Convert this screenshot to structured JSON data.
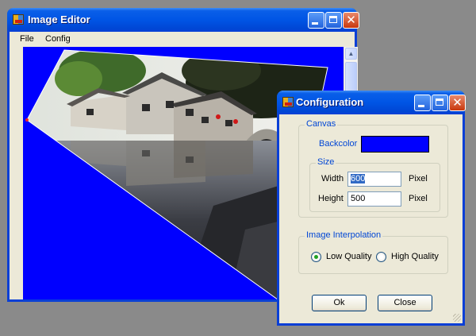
{
  "editor": {
    "title": "Image Editor",
    "menu": [
      "File",
      "Config"
    ],
    "controls": {
      "minimize": "minimize-icon",
      "maximize": "maximize-icon",
      "close": "close-icon"
    }
  },
  "config": {
    "title": "Configuration",
    "canvas_group": "Canvas",
    "backcolor_label": "Backcolor",
    "backcolor_value": "#0000ff",
    "size_group": "Size",
    "width_label": "Width",
    "width_value": "600",
    "height_label": "Height",
    "height_value": "500",
    "unit": "Pixel",
    "interp_group": "Image Interpolation",
    "interp_options": [
      "Low Quality",
      "High Quality"
    ],
    "interp_selected": "Low Quality",
    "ok": "Ok",
    "close": "Close"
  },
  "colors": {
    "titlebar": "#0055e5",
    "canvas": "#0000ff",
    "window_face": "#ece9d8",
    "group_label": "#0046d5"
  }
}
